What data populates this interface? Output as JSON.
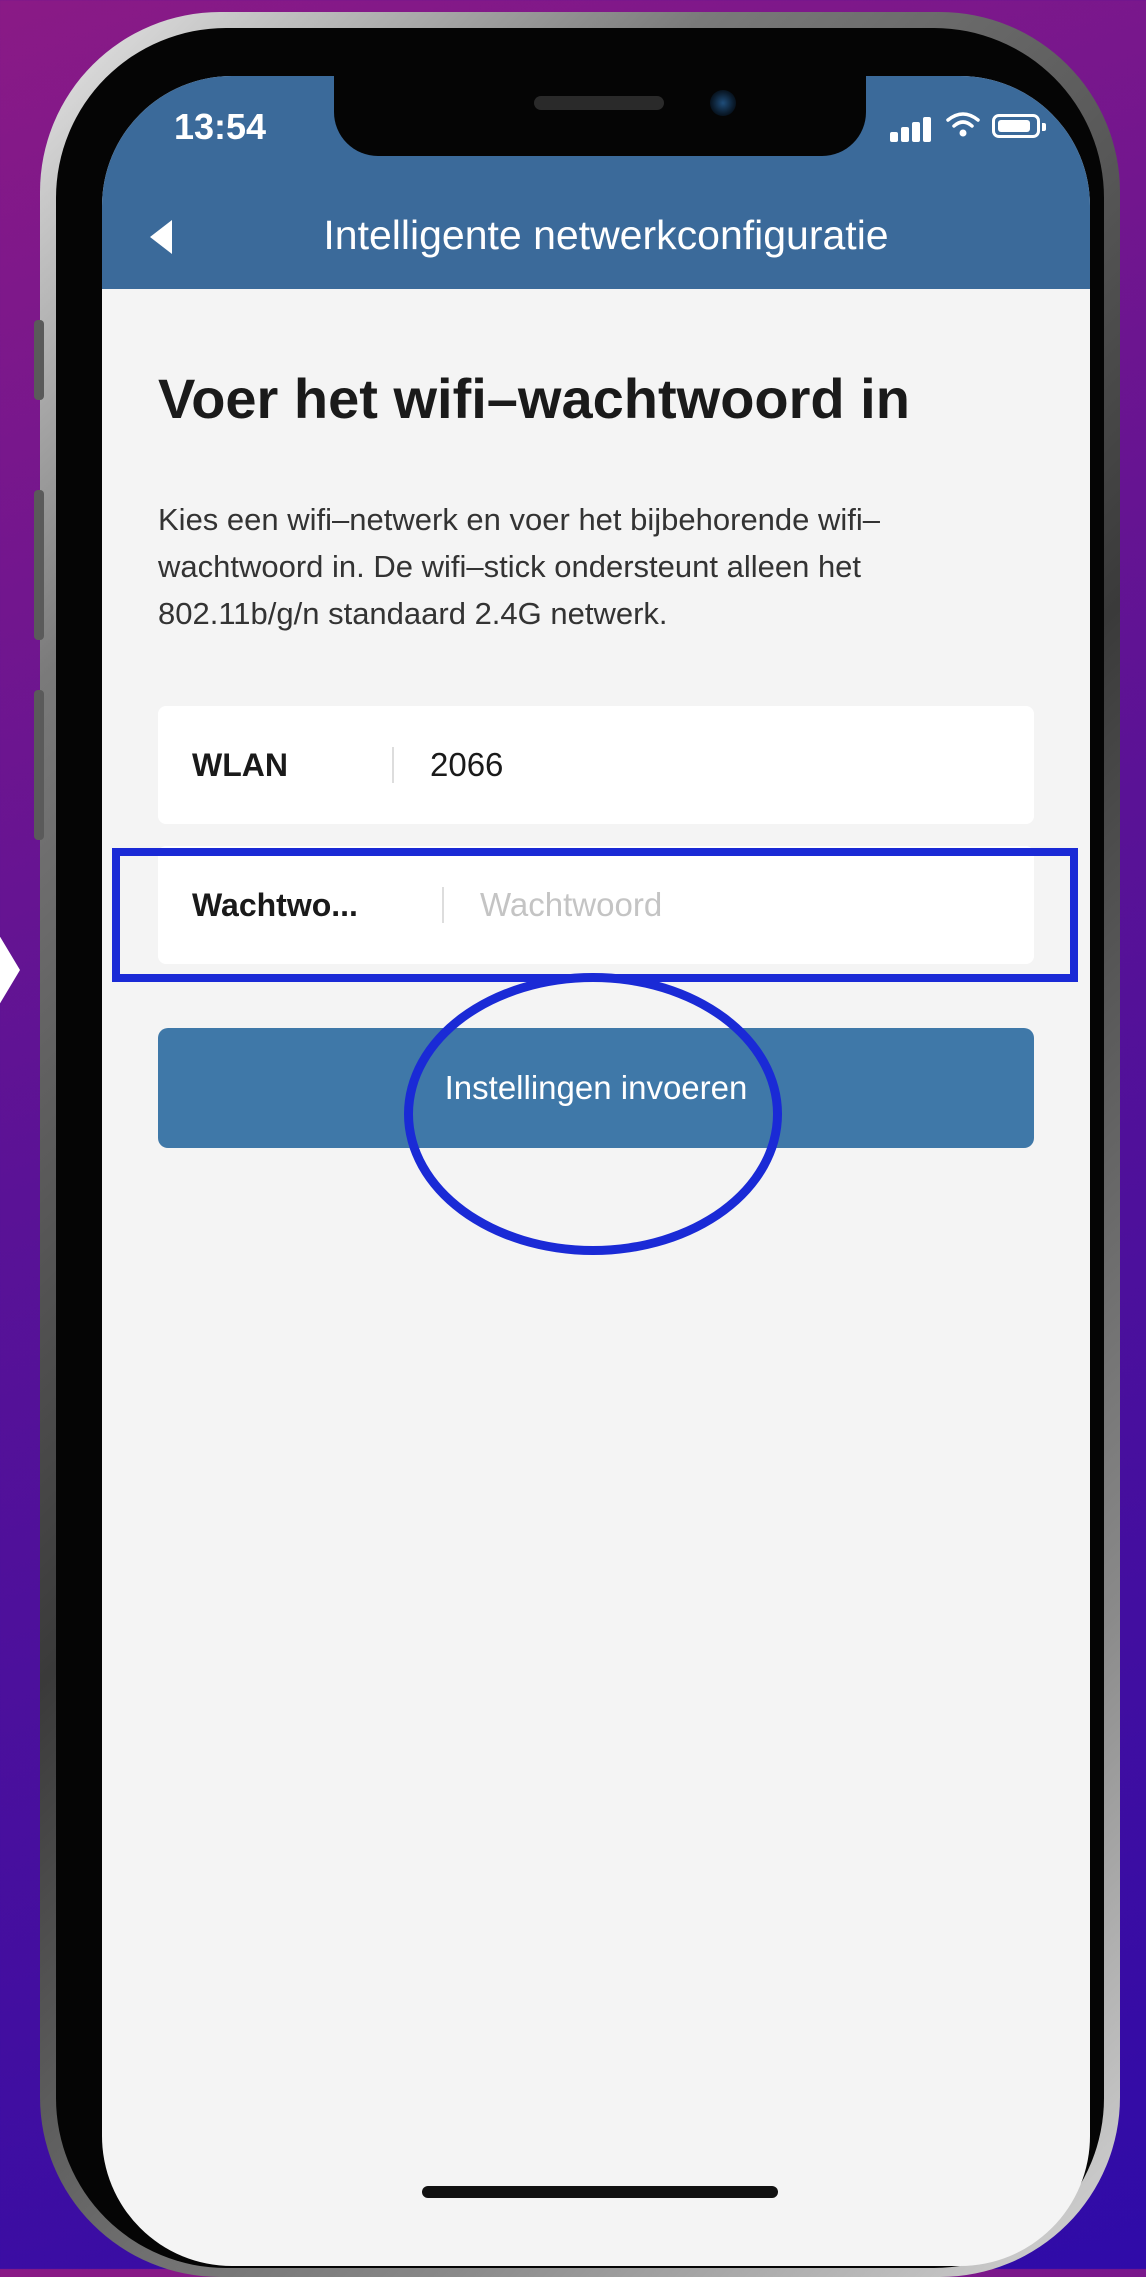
{
  "status_bar": {
    "time": "13:54",
    "icons": [
      "signal-icon",
      "wifi-icon",
      "battery-icon"
    ]
  },
  "nav": {
    "back_icon": "back-icon",
    "title": "Intelligente netwerkconfiguratie"
  },
  "page": {
    "title": "Voer het wifi–wachtwoord in",
    "description": "Kies een wifi–netwerk en voer het bijbehorende wifi–wachtwoord in. De wifi–stick ondersteunt alleen het 802.11b/g/n standaard 2.4G netwerk."
  },
  "form": {
    "wlan": {
      "label": "WLAN",
      "value": "2066"
    },
    "password": {
      "label": "Wachtwo...",
      "value": "",
      "placeholder": "Wachtwoord"
    },
    "submit_label": "Instellingen invoeren"
  },
  "colors": {
    "header": "#3b6a9a",
    "button": "#3f78a8",
    "screen_bg": "#f4f4f4",
    "annotation": "#1a2ad6"
  }
}
